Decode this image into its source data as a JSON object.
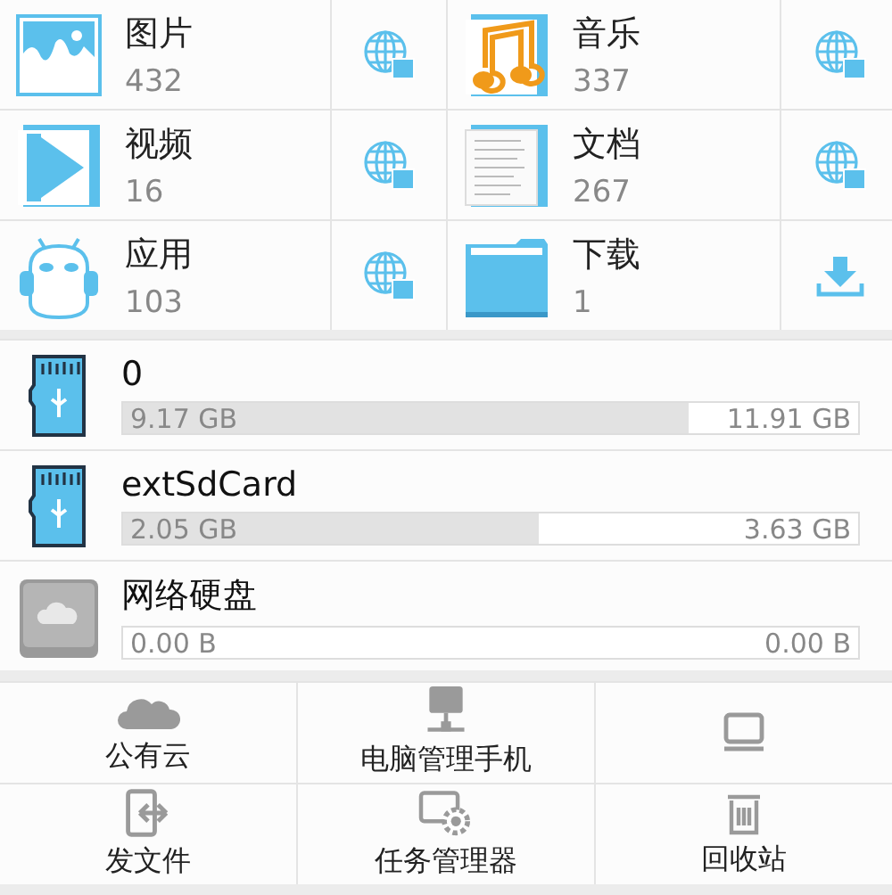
{
  "categories": [
    {
      "name": "图片",
      "count": "432",
      "kind": "pictures",
      "action": {
        "kind": "web"
      }
    },
    {
      "name": "音乐",
      "count": "337",
      "kind": "music",
      "action": {
        "kind": "web"
      }
    },
    {
      "name": "视频",
      "count": "16",
      "kind": "video",
      "action": {
        "kind": "web"
      }
    },
    {
      "name": "文档",
      "count": "267",
      "kind": "documents",
      "action": {
        "kind": "web"
      }
    },
    {
      "name": "应用",
      "count": "103",
      "kind": "apps",
      "action": {
        "kind": "web"
      }
    },
    {
      "name": "下载",
      "count": "1",
      "kind": "downloads",
      "action": {
        "kind": "download"
      }
    }
  ],
  "storage": [
    {
      "name": "0",
      "used": "9.17 GB",
      "total": "11.91 GB",
      "level": 0.77,
      "kind": "sd"
    },
    {
      "name": "extSdCard",
      "used": "2.05 GB",
      "total": "3.63 GB",
      "level": 0.565,
      "kind": "sd"
    },
    {
      "name": "网络硬盘",
      "used": "0.00 B",
      "total": "0.00 B",
      "kind": "cloud"
    }
  ],
  "tools": [
    {
      "label": "公有云",
      "kind": "cloud"
    },
    {
      "label": "电脑管理手机",
      "kind": "ftp"
    },
    {
      "kind": "monitor"
    },
    {
      "label": "发文件",
      "kind": "send"
    },
    {
      "label": "任务管理器",
      "kind": "tasks"
    },
    {
      "label": "回收站",
      "kind": "bin"
    }
  ]
}
